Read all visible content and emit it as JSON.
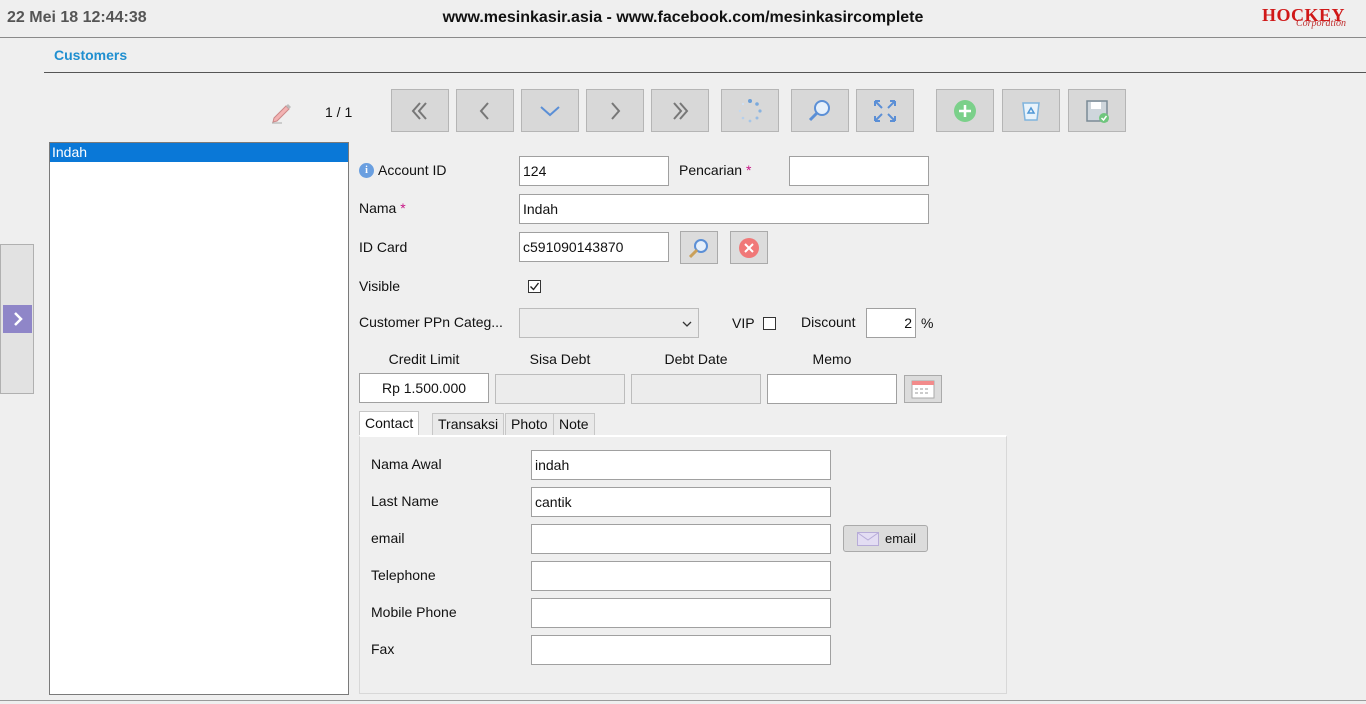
{
  "header": {
    "datetime": "22 Mei 18 12:44:38",
    "website": "www.mesinkasir.asia - www.facebook.com/mesinkasircomplete",
    "logo": {
      "name": "HOCKEY",
      "tagline": "Corporation"
    }
  },
  "page": {
    "title": "Customers"
  },
  "toolbar": {
    "record_counter": "1 / 1",
    "buttons": [
      {
        "id": "first",
        "icon": "first-record-icon"
      },
      {
        "id": "prev",
        "icon": "previous-record-icon"
      },
      {
        "id": "down",
        "icon": "chevron-down-icon"
      },
      {
        "id": "next",
        "icon": "next-record-icon"
      },
      {
        "id": "last",
        "icon": "last-record-icon"
      },
      {
        "id": "reload",
        "icon": "reload-icon"
      },
      {
        "id": "search",
        "icon": "search-icon"
      },
      {
        "id": "fullscreen",
        "icon": "expand-icon"
      },
      {
        "id": "add",
        "icon": "add-icon"
      },
      {
        "id": "delete",
        "icon": "recycle-delete-icon"
      },
      {
        "id": "save",
        "icon": "save-icon"
      }
    ]
  },
  "customer_list": {
    "items": [
      "Indah"
    ],
    "selected_index": 0
  },
  "form": {
    "account_id": {
      "label": "Account ID",
      "value": "124"
    },
    "pencarian": {
      "label": "Pencarian",
      "required_mark": "*",
      "value": ""
    },
    "nama": {
      "label": "Nama",
      "required_mark": "*",
      "value": "Indah"
    },
    "id_card": {
      "label": "ID Card",
      "value": "c591090143870"
    },
    "visible": {
      "label": "Visible",
      "checked": true
    },
    "ppn_category": {
      "label": "Customer PPn Categ...",
      "value": ""
    },
    "vip": {
      "label": "VIP",
      "checked": false
    },
    "discount": {
      "label": "Discount",
      "value": "2",
      "unit": "%"
    },
    "credit_limit": {
      "label": "Credit Limit",
      "value": "Rp 1.500.000"
    },
    "sisa_debt": {
      "label": "Sisa Debt",
      "value": ""
    },
    "debt_date": {
      "label": "Debt Date",
      "value": ""
    },
    "memo": {
      "label": "Memo",
      "value": ""
    }
  },
  "tabs": [
    {
      "label": "Contact",
      "active": true
    },
    {
      "label": "Transaksi",
      "active": false
    },
    {
      "label": "Photo",
      "active": false
    },
    {
      "label": "Note",
      "active": false
    }
  ],
  "contact": {
    "nama_awal": {
      "label": "Nama Awal",
      "value": "indah"
    },
    "last_name": {
      "label": "Last Name",
      "value": "cantik"
    },
    "email": {
      "label": "email",
      "value": "",
      "button_label": "email"
    },
    "telephone": {
      "label": "Telephone",
      "value": ""
    },
    "mobile_phone": {
      "label": "Mobile Phone",
      "value": ""
    },
    "fax": {
      "label": "Fax",
      "value": ""
    }
  },
  "colors": {
    "title_blue": "#1f8fd0",
    "selection_blue": "#0a78d7",
    "required_magenta": "#c71585",
    "logo_red": "#d01818",
    "side_toggle_purple": "#8f86c8"
  }
}
